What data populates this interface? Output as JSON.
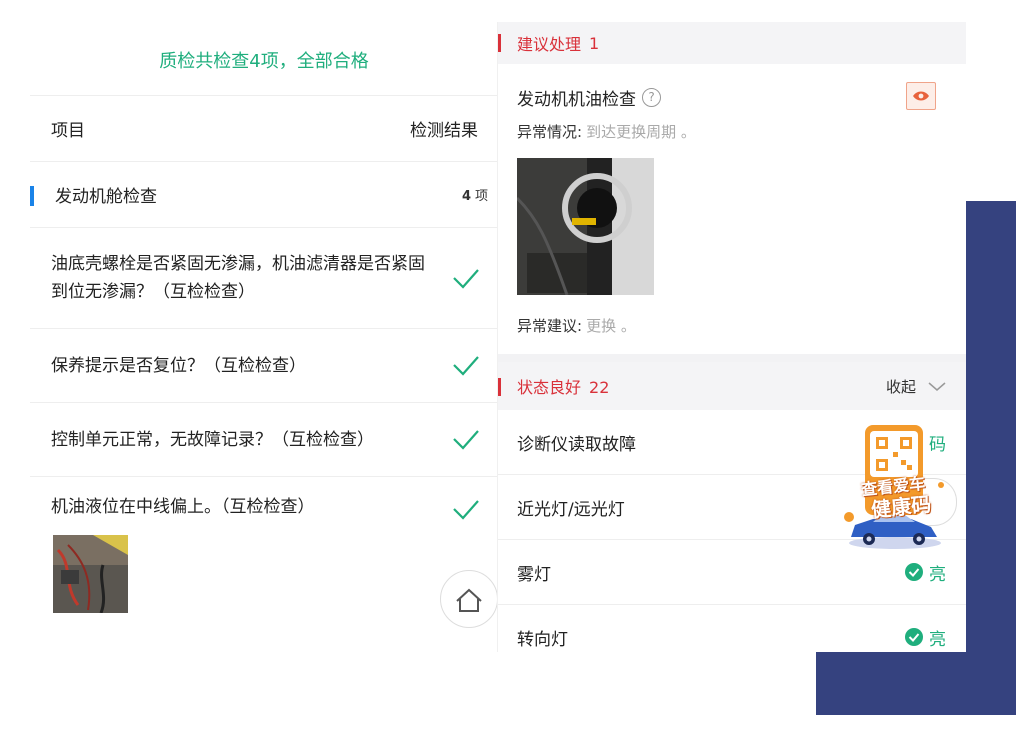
{
  "left": {
    "summary": "质检共检查4项，全部合格",
    "header": {
      "item": "项目",
      "result": "检测结果"
    },
    "section": {
      "name": "发动机舱检查",
      "count": "4",
      "count_unit": "项"
    },
    "items": [
      {
        "text": "油底壳螺栓是否紧固无渗漏，机油滤清器是否紧固到位无渗漏？（互检检查）"
      },
      {
        "text": "保养提示是否复位？（互检检查）"
      },
      {
        "text": "控制单元正常，无故障记录？（互检检查）"
      },
      {
        "text": "机油液位在中线偏上。（互检检查）"
      }
    ]
  },
  "right": {
    "suggest": {
      "label": "建议处理",
      "count": "1"
    },
    "issue": {
      "title": "发动机机油检查",
      "abnormal_label": "异常情况:",
      "abnormal_value": "到达更换周期 。",
      "advice_label": "异常建议:",
      "advice_value": "更换 。"
    },
    "good": {
      "label": "状态良好",
      "count": "22",
      "collapse": "收起"
    },
    "rows": [
      {
        "name": "诊断仪读取故障",
        "status": "码"
      },
      {
        "name": "近光灯/远光灯",
        "status": ""
      },
      {
        "name": "雾灯",
        "status": "亮"
      },
      {
        "name": "转向灯",
        "status": "亮"
      }
    ]
  },
  "promo": {
    "line1": "查看爱车",
    "line2": "健康码"
  },
  "colors": {
    "green": "#1fae7d",
    "red": "#d9313a",
    "blue": "#1a83e8",
    "navy": "#35427f"
  }
}
